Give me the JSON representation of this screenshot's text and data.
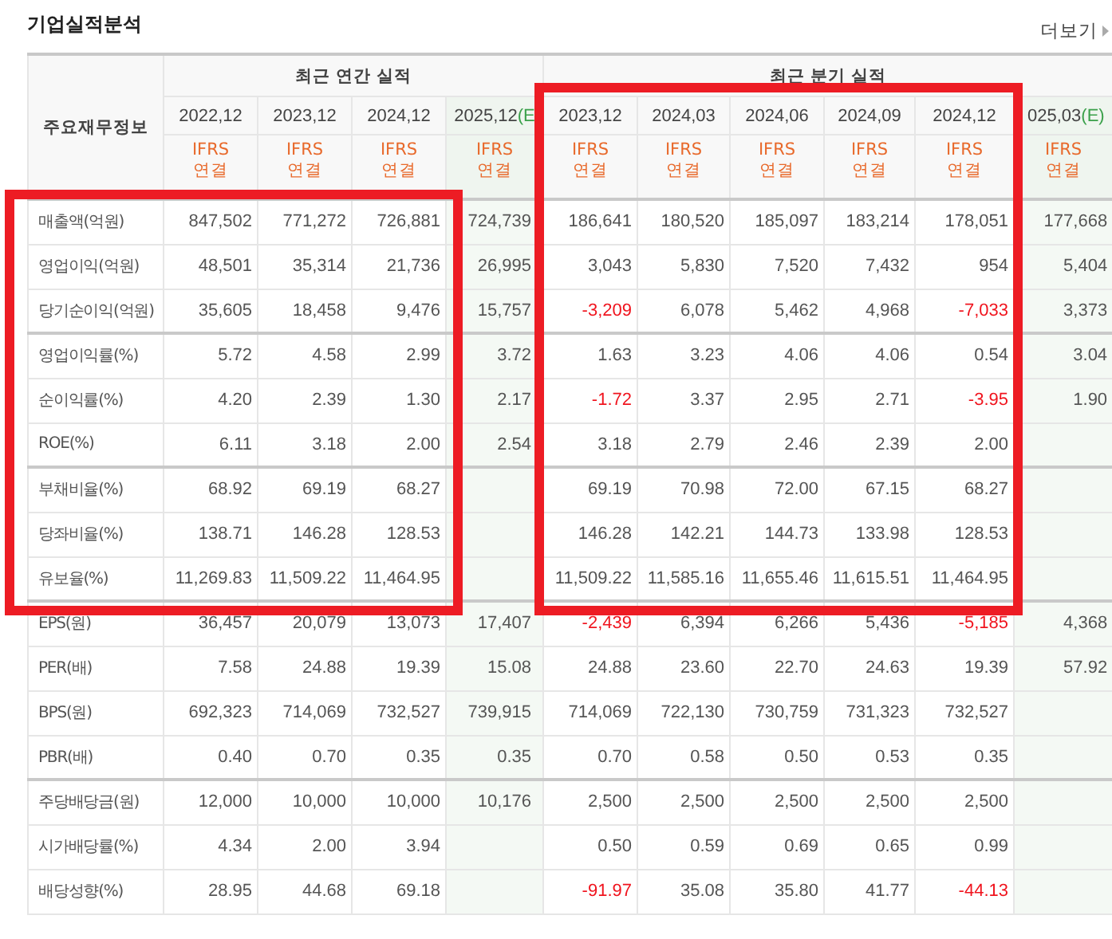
{
  "section": {
    "title": "기업실적분석",
    "more_link": "더보기"
  },
  "table": {
    "corner_header": "주요재무정보",
    "annual": {
      "label": "최근 연간 실적",
      "columns": [
        {
          "period": "2022,12",
          "standard": "IFRS",
          "basis": "연결"
        },
        {
          "period": "2023,12",
          "standard": "IFRS",
          "basis": "연결"
        },
        {
          "period": "2024,12",
          "standard": "IFRS",
          "basis": "연결"
        }
      ],
      "estimate_column": {
        "period": "2025,12",
        "suffix": "(E",
        "standard": "IFRS",
        "basis": "연결"
      }
    },
    "quarterly": {
      "label": "최근 분기 실적",
      "columns": [
        {
          "period": "2023,12",
          "standard": "IFRS",
          "basis": "연결"
        },
        {
          "period": "2024,03",
          "standard": "IFRS",
          "basis": "연결"
        },
        {
          "period": "2024,06",
          "standard": "IFRS",
          "basis": "연결"
        },
        {
          "period": "2024,09",
          "standard": "IFRS",
          "basis": "연결"
        },
        {
          "period": "2024,12",
          "standard": "IFRS",
          "basis": "연결"
        }
      ],
      "estimate_column": {
        "period": "025,03",
        "suffix": "(E)",
        "standard": "IFRS",
        "basis": "연결"
      }
    },
    "rows": [
      {
        "label": "매출액(억원)",
        "group_start": true,
        "annual": [
          {
            "text": "847,502",
            "negative": false
          },
          {
            "text": "771,272",
            "negative": false
          },
          {
            "text": "726,881",
            "negative": false
          }
        ],
        "annual_estimate": {
          "text": "724,739",
          "negative": false
        },
        "quarterly": [
          {
            "text": "186,641",
            "negative": false
          },
          {
            "text": "180,520",
            "negative": false
          },
          {
            "text": "185,097",
            "negative": false
          },
          {
            "text": "183,214",
            "negative": false
          },
          {
            "text": "178,051",
            "negative": false
          }
        ],
        "quarterly_estimate": {
          "text": "177,668",
          "negative": false
        }
      },
      {
        "label": "영업이익(억원)",
        "group_start": false,
        "annual": [
          {
            "text": "48,501",
            "negative": false
          },
          {
            "text": "35,314",
            "negative": false
          },
          {
            "text": "21,736",
            "negative": false
          }
        ],
        "annual_estimate": {
          "text": "26,995",
          "negative": false
        },
        "quarterly": [
          {
            "text": "3,043",
            "negative": false
          },
          {
            "text": "5,830",
            "negative": false
          },
          {
            "text": "7,520",
            "negative": false
          },
          {
            "text": "7,432",
            "negative": false
          },
          {
            "text": "954",
            "negative": false
          }
        ],
        "quarterly_estimate": {
          "text": "5,404",
          "negative": false
        }
      },
      {
        "label": "당기순이익(억원)",
        "group_start": false,
        "annual": [
          {
            "text": "35,605",
            "negative": false
          },
          {
            "text": "18,458",
            "negative": false
          },
          {
            "text": "9,476",
            "negative": false
          }
        ],
        "annual_estimate": {
          "text": "15,757",
          "negative": false
        },
        "quarterly": [
          {
            "text": "-3,209",
            "negative": true
          },
          {
            "text": "6,078",
            "negative": false
          },
          {
            "text": "5,462",
            "negative": false
          },
          {
            "text": "4,968",
            "negative": false
          },
          {
            "text": "-7,033",
            "negative": true
          }
        ],
        "quarterly_estimate": {
          "text": "3,373",
          "negative": false
        }
      },
      {
        "label": "영업이익률(%)",
        "group_start": true,
        "annual": [
          {
            "text": "5.72",
            "negative": false
          },
          {
            "text": "4.58",
            "negative": false
          },
          {
            "text": "2.99",
            "negative": false
          }
        ],
        "annual_estimate": {
          "text": "3.72",
          "negative": false
        },
        "quarterly": [
          {
            "text": "1.63",
            "negative": false
          },
          {
            "text": "3.23",
            "negative": false
          },
          {
            "text": "4.06",
            "negative": false
          },
          {
            "text": "4.06",
            "negative": false
          },
          {
            "text": "0.54",
            "negative": false
          }
        ],
        "quarterly_estimate": {
          "text": "3.04",
          "negative": false
        }
      },
      {
        "label": "순이익률(%)",
        "group_start": false,
        "annual": [
          {
            "text": "4.20",
            "negative": false
          },
          {
            "text": "2.39",
            "negative": false
          },
          {
            "text": "1.30",
            "negative": false
          }
        ],
        "annual_estimate": {
          "text": "2.17",
          "negative": false
        },
        "quarterly": [
          {
            "text": "-1.72",
            "negative": true
          },
          {
            "text": "3.37",
            "negative": false
          },
          {
            "text": "2.95",
            "negative": false
          },
          {
            "text": "2.71",
            "negative": false
          },
          {
            "text": "-3.95",
            "negative": true
          }
        ],
        "quarterly_estimate": {
          "text": "1.90",
          "negative": false
        }
      },
      {
        "label": "ROE(%)",
        "group_start": false,
        "annual": [
          {
            "text": "6.11",
            "negative": false
          },
          {
            "text": "3.18",
            "negative": false
          },
          {
            "text": "2.00",
            "negative": false
          }
        ],
        "annual_estimate": {
          "text": "2.54",
          "negative": false
        },
        "quarterly": [
          {
            "text": "3.18",
            "negative": false
          },
          {
            "text": "2.79",
            "negative": false
          },
          {
            "text": "2.46",
            "negative": false
          },
          {
            "text": "2.39",
            "negative": false
          },
          {
            "text": "2.00",
            "negative": false
          }
        ]
      },
      {
        "label": "부채비율(%)",
        "group_start": true,
        "annual": [
          {
            "text": "68.92",
            "negative": false
          },
          {
            "text": "69.19",
            "negative": false
          },
          {
            "text": "68.27",
            "negative": false
          }
        ],
        "quarterly": [
          {
            "text": "69.19",
            "negative": false
          },
          {
            "text": "70.98",
            "negative": false
          },
          {
            "text": "72.00",
            "negative": false
          },
          {
            "text": "67.15",
            "negative": false
          },
          {
            "text": "68.27",
            "negative": false
          }
        ]
      },
      {
        "label": "당좌비율(%)",
        "group_start": false,
        "annual": [
          {
            "text": "138.71",
            "negative": false
          },
          {
            "text": "146.28",
            "negative": false
          },
          {
            "text": "128.53",
            "negative": false
          }
        ],
        "quarterly": [
          {
            "text": "146.28",
            "negative": false
          },
          {
            "text": "142.21",
            "negative": false
          },
          {
            "text": "144.73",
            "negative": false
          },
          {
            "text": "133.98",
            "negative": false
          },
          {
            "text": "128.53",
            "negative": false
          }
        ]
      },
      {
        "label": "유보율(%)",
        "group_start": false,
        "annual": [
          {
            "text": "11,269.83",
            "negative": false
          },
          {
            "text": "11,509.22",
            "negative": false
          },
          {
            "text": "11,464.95",
            "negative": false
          }
        ],
        "quarterly": [
          {
            "text": "11,509.22",
            "negative": false
          },
          {
            "text": "11,585.16",
            "negative": false
          },
          {
            "text": "11,655.46",
            "negative": false
          },
          {
            "text": "11,615.51",
            "negative": false
          },
          {
            "text": "11,464.95",
            "negative": false
          }
        ]
      },
      {
        "label": "EPS(원)",
        "group_start": true,
        "annual": [
          {
            "text": "36,457",
            "negative": false
          },
          {
            "text": "20,079",
            "negative": false
          },
          {
            "text": "13,073",
            "negative": false
          }
        ],
        "annual_estimate": {
          "text": "17,407",
          "negative": false
        },
        "quarterly": [
          {
            "text": "-2,439",
            "negative": true
          },
          {
            "text": "6,394",
            "negative": false
          },
          {
            "text": "6,266",
            "negative": false
          },
          {
            "text": "5,436",
            "negative": false
          },
          {
            "text": "-5,185",
            "negative": true
          }
        ],
        "quarterly_estimate": {
          "text": "4,368",
          "negative": false
        }
      },
      {
        "label": "PER(배)",
        "group_start": false,
        "annual": [
          {
            "text": "7.58",
            "negative": false
          },
          {
            "text": "24.88",
            "negative": false
          },
          {
            "text": "19.39",
            "negative": false
          }
        ],
        "annual_estimate": {
          "text": "15.08",
          "negative": false
        },
        "quarterly": [
          {
            "text": "24.88",
            "negative": false
          },
          {
            "text": "23.60",
            "negative": false
          },
          {
            "text": "22.70",
            "negative": false
          },
          {
            "text": "24.63",
            "negative": false
          },
          {
            "text": "19.39",
            "negative": false
          }
        ],
        "quarterly_estimate": {
          "text": "57.92",
          "negative": false
        }
      },
      {
        "label": "BPS(원)",
        "group_start": false,
        "annual": [
          {
            "text": "692,323",
            "negative": false
          },
          {
            "text": "714,069",
            "negative": false
          },
          {
            "text": "732,527",
            "negative": false
          }
        ],
        "annual_estimate": {
          "text": "739,915",
          "negative": false
        },
        "quarterly": [
          {
            "text": "714,069",
            "negative": false
          },
          {
            "text": "722,130",
            "negative": false
          },
          {
            "text": "730,759",
            "negative": false
          },
          {
            "text": "731,323",
            "negative": false
          },
          {
            "text": "732,527",
            "negative": false
          }
        ]
      },
      {
        "label": "PBR(배)",
        "group_start": false,
        "annual": [
          {
            "text": "0.40",
            "negative": false
          },
          {
            "text": "0.70",
            "negative": false
          },
          {
            "text": "0.35",
            "negative": false
          }
        ],
        "annual_estimate": {
          "text": "0.35",
          "negative": false
        },
        "quarterly": [
          {
            "text": "0.70",
            "negative": false
          },
          {
            "text": "0.58",
            "negative": false
          },
          {
            "text": "0.50",
            "negative": false
          },
          {
            "text": "0.53",
            "negative": false
          },
          {
            "text": "0.35",
            "negative": false
          }
        ]
      },
      {
        "label": "주당배당금(원)",
        "group_start": true,
        "annual": [
          {
            "text": "12,000",
            "negative": false
          },
          {
            "text": "10,000",
            "negative": false
          },
          {
            "text": "10,000",
            "negative": false
          }
        ],
        "annual_estimate": {
          "text": "10,176",
          "negative": false
        },
        "quarterly": [
          {
            "text": "2,500",
            "negative": false
          },
          {
            "text": "2,500",
            "negative": false
          },
          {
            "text": "2,500",
            "negative": false
          },
          {
            "text": "2,500",
            "negative": false
          },
          {
            "text": "2,500",
            "negative": false
          }
        ]
      },
      {
        "label": "시가배당률(%)",
        "group_start": false,
        "annual": [
          {
            "text": "4.34",
            "negative": false
          },
          {
            "text": "2.00",
            "negative": false
          },
          {
            "text": "3.94",
            "negative": false
          }
        ],
        "quarterly": [
          {
            "text": "0.50",
            "negative": false
          },
          {
            "text": "0.59",
            "negative": false
          },
          {
            "text": "0.69",
            "negative": false
          },
          {
            "text": "0.65",
            "negative": false
          },
          {
            "text": "0.99",
            "negative": false
          }
        ]
      },
      {
        "label": "배당성향(%)",
        "group_start": false,
        "annual": [
          {
            "text": "28.95",
            "negative": false
          },
          {
            "text": "44.68",
            "negative": false
          },
          {
            "text": "69.18",
            "negative": false
          }
        ],
        "quarterly": [
          {
            "text": "-91.97",
            "negative": true
          },
          {
            "text": "35.08",
            "negative": false
          },
          {
            "text": "35.80",
            "negative": false
          },
          {
            "text": "41.77",
            "negative": false
          },
          {
            "text": "-44.13",
            "negative": true
          }
        ]
      }
    ]
  }
}
